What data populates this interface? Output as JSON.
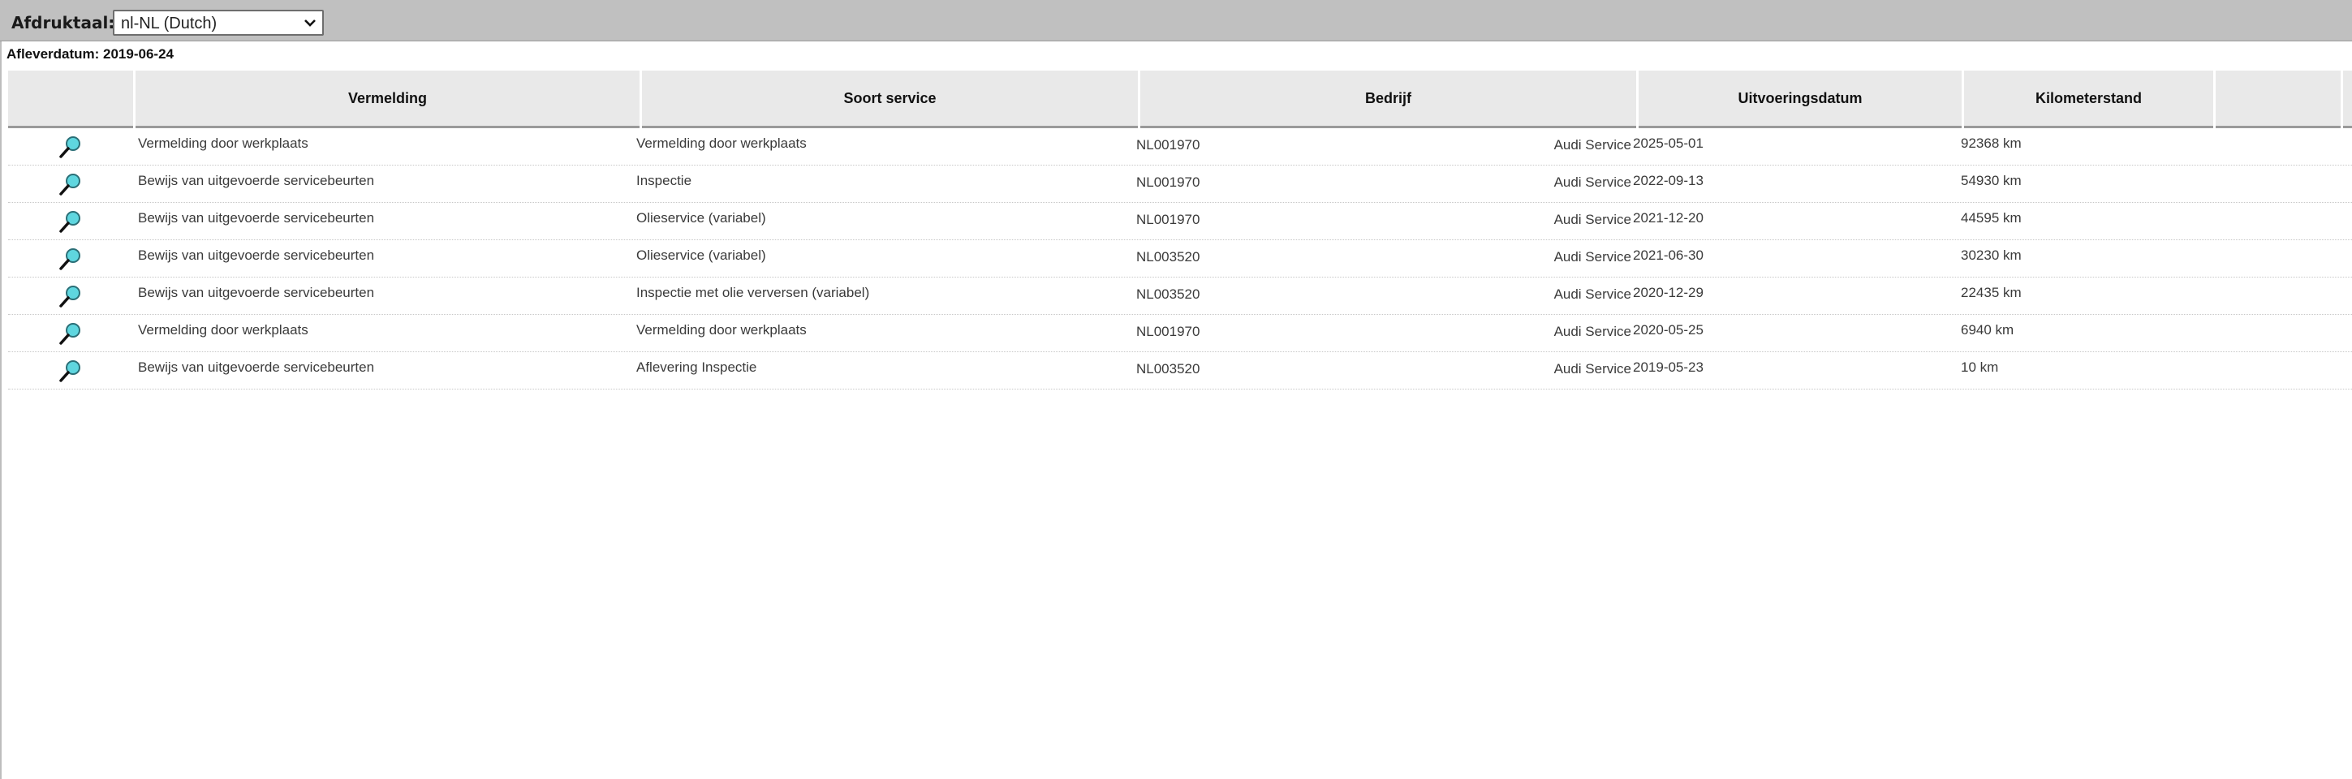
{
  "toolbar": {
    "print_language_label": "Afdruktaal:",
    "print_language_value": "nl-NL (Dutch)"
  },
  "delivery_date": "Afleverdatum: 2019-06-24",
  "table": {
    "columns": [
      "",
      "Vermelding",
      "Soort service",
      "Bedrijf",
      "Uitvoeringsdatum",
      "Kilometerstand",
      "",
      ""
    ],
    "rows": [
      {
        "icon": "magnifier-icon",
        "vermelding": "Vermelding door werkplaats",
        "soort": "Vermelding door werkplaats",
        "dealer": "NL001970",
        "bedrijf": "Audi Service",
        "datum": "2025-05-01",
        "km": "92368 km"
      },
      {
        "icon": "magnifier-icon",
        "vermelding": "Bewijs van uitgevoerde servicebeurten",
        "soort": "Inspectie",
        "dealer": "NL001970",
        "bedrijf": "Audi Service",
        "datum": "2022-09-13",
        "km": "54930 km"
      },
      {
        "icon": "magnifier-icon",
        "vermelding": "Bewijs van uitgevoerde servicebeurten",
        "soort": "Olieservice (variabel)",
        "dealer": "NL001970",
        "bedrijf": "Audi Service",
        "datum": "2021-12-20",
        "km": "44595 km"
      },
      {
        "icon": "magnifier-icon",
        "vermelding": "Bewijs van uitgevoerde servicebeurten",
        "soort": "Olieservice (variabel)",
        "dealer": "NL003520",
        "bedrijf": "Audi Service",
        "datum": "2021-06-30",
        "km": "30230 km"
      },
      {
        "icon": "magnifier-icon",
        "vermelding": "Bewijs van uitgevoerde servicebeurten",
        "soort": "Inspectie met olie verversen (variabel)",
        "dealer": "NL003520",
        "bedrijf": "Audi Service",
        "datum": "2020-12-29",
        "km": "22435 km"
      },
      {
        "icon": "magnifier-icon",
        "vermelding": "Vermelding door werkplaats",
        "soort": "Vermelding door werkplaats",
        "dealer": "NL001970",
        "bedrijf": "Audi Service",
        "datum": "2020-05-25",
        "km": "6940 km"
      },
      {
        "icon": "magnifier-icon",
        "vermelding": "Bewijs van uitgevoerde servicebeurten",
        "soort": "Aflevering Inspectie",
        "dealer": "NL003520",
        "bedrijf": "Audi Service",
        "datum": "2019-05-23",
        "km": "10 km"
      }
    ]
  },
  "colors": {
    "toolbar_bg": "#c0c0c0",
    "header_bg": "#e9e9e9",
    "magnifier_lens": "#5fd6df"
  }
}
